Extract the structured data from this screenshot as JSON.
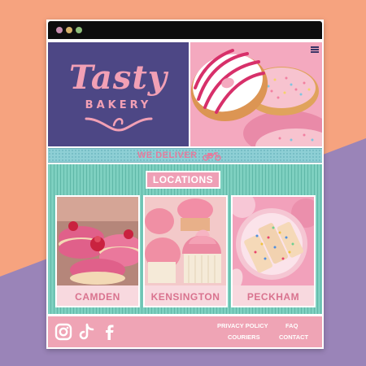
{
  "colors": {
    "background_orange": "#f6a37f",
    "background_purple": "#9a84b8",
    "navy": "#4d4785",
    "pink": "#efa4b5",
    "mint": "#7ed0c0",
    "teal_band": "#8ecfd5"
  },
  "window": {
    "controls": [
      "close-dot",
      "minimize-dot",
      "maximize-dot"
    ]
  },
  "brand": {
    "logo_main": "Tasty",
    "logo_sub": "BAKERY"
  },
  "header": {
    "menu_icon": "hamburger-menu-icon"
  },
  "banner": {
    "text": "WE DELIVER",
    "icon": "scooter-icon"
  },
  "locations": {
    "title": "LOCATIONS",
    "items": [
      {
        "label": "CAMDEN",
        "photo": "macarons-photo"
      },
      {
        "label": "KENSINGTON",
        "photo": "cupcakes-photo"
      },
      {
        "label": "PECKHAM",
        "photo": "sprinkle-cookies-photo"
      }
    ]
  },
  "footer": {
    "social": [
      "instagram-icon",
      "tiktok-icon",
      "facebook-icon"
    ],
    "links": {
      "privacy": "PRIVACY POLICY",
      "faq": "FAQ",
      "couriers": "COURIERS",
      "contact": "CONTACT"
    }
  }
}
